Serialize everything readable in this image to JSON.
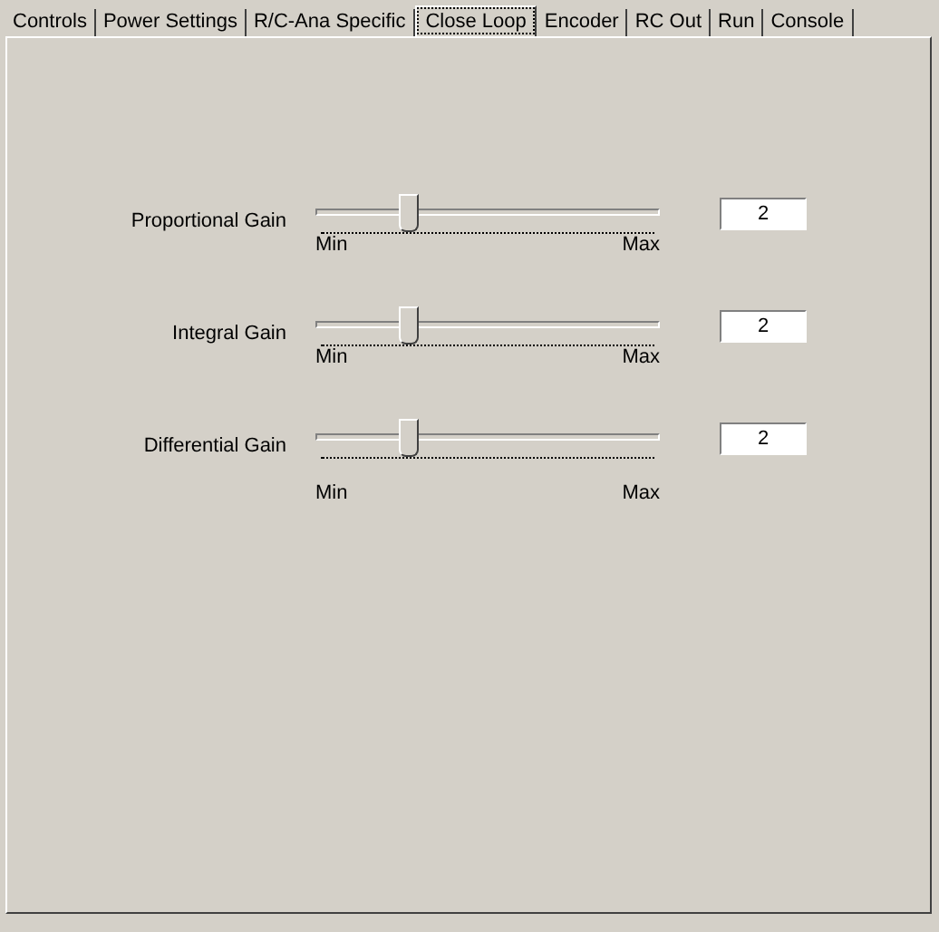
{
  "tabs": [
    {
      "label": "Controls",
      "selected": false
    },
    {
      "label": "Power Settings",
      "selected": false
    },
    {
      "label": "R/C-Ana Specific",
      "selected": false
    },
    {
      "label": "Close Loop",
      "selected": true
    },
    {
      "label": "Encoder",
      "selected": false
    },
    {
      "label": "RC Out",
      "selected": false
    },
    {
      "label": "Run",
      "selected": false
    },
    {
      "label": "Console",
      "selected": false
    }
  ],
  "sliders": [
    {
      "label": "Proportional Gain",
      "level": 0.27,
      "min": "Min",
      "max": "Max",
      "value": "2"
    },
    {
      "label": "Integral Gain",
      "level": 0.27,
      "min": "Min",
      "max": "Max",
      "value": "2"
    },
    {
      "label": "Differential Gain",
      "level": 0.27,
      "min": "Min",
      "max": "Max",
      "value": "2"
    }
  ]
}
